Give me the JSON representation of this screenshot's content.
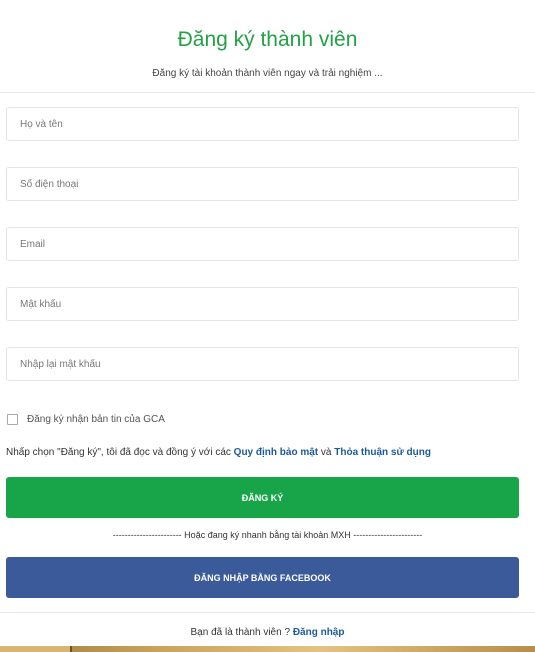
{
  "header": {
    "title": "Đăng ký thành viên",
    "subtitle": "Đăng ký tài khoản thành viên ngay và trải nghiệm ..."
  },
  "form": {
    "fullname_placeholder": "Họ và tên",
    "phone_placeholder": "Số điện thoại",
    "email_placeholder": "Email",
    "password_placeholder": "Mật khẩu",
    "confirm_password_placeholder": "Nhập lại mật khẩu"
  },
  "newsletter": {
    "label": "Đăng ký nhận bản tin của GCA",
    "checked": false
  },
  "terms": {
    "prefix": "Nhấp chọn \"Đăng ký\", tôi đã đọc và đồng ý với các ",
    "privacy_link": "Quy định bảo mật",
    "conjunction": " và ",
    "agreement_link": "Thỏa thuận sử dụng"
  },
  "buttons": {
    "register": "ĐĂNG KÝ",
    "facebook": "ĐĂNG NHẬP BẰNG FACEBOOK"
  },
  "divider": {
    "text": "----------------------- Hoặc đang ký nhanh bằng tài khoản MXH -----------------------"
  },
  "footer": {
    "question": "Bạn đã là thành viên ? ",
    "login_link": "Đăng nhập"
  },
  "colors": {
    "title": "#22a145",
    "register_button": "#18a54a",
    "facebook_button": "#3b5a9a",
    "link": "#1c5a9b"
  }
}
